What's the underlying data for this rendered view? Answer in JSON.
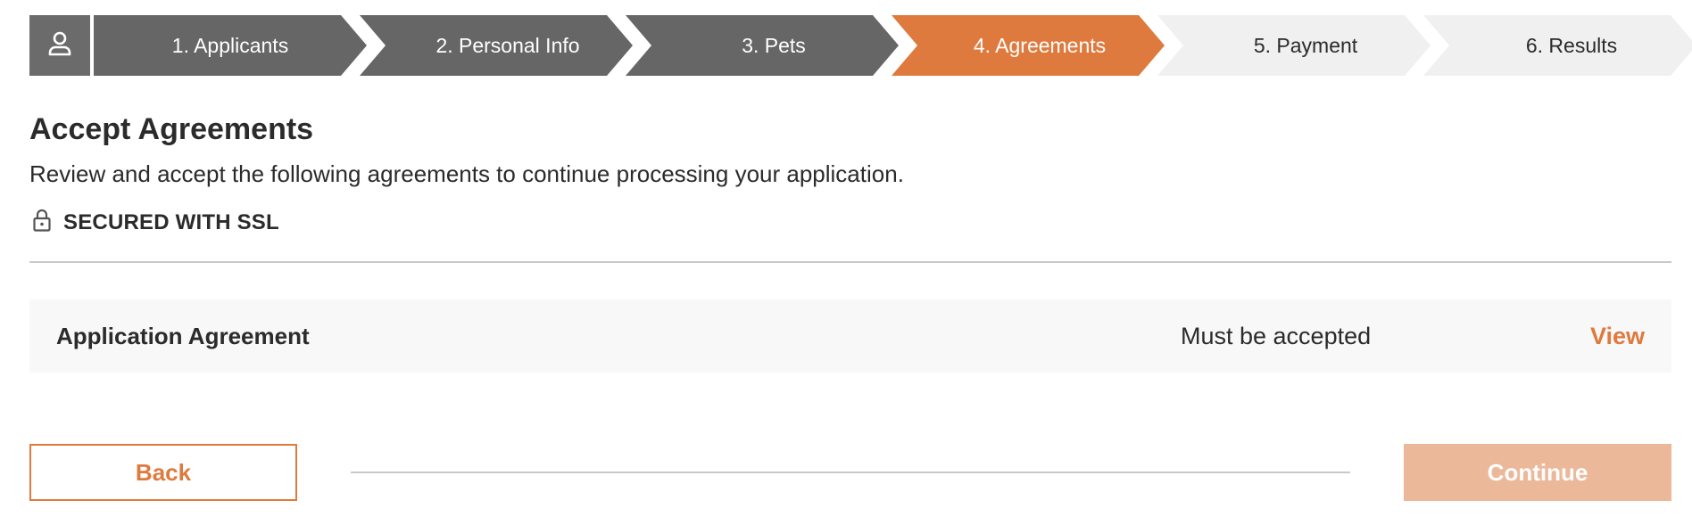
{
  "stepper": {
    "steps": [
      {
        "label": "1. Applicants",
        "state": "done"
      },
      {
        "label": "2. Personal Info",
        "state": "done"
      },
      {
        "label": "3. Pets",
        "state": "done"
      },
      {
        "label": "4. Agreements",
        "state": "active"
      },
      {
        "label": "5. Payment",
        "state": "todo"
      },
      {
        "label": "6. Results",
        "state": "todo"
      }
    ],
    "icon": "user-icon"
  },
  "header": {
    "title": "Accept Agreements",
    "subtitle": "Review and accept the following agreements to continue processing your application.",
    "security_label": "SECURED WITH SSL",
    "security_icon": "lock-icon"
  },
  "agreements": [
    {
      "name": "Application Agreement",
      "status": "Must be accepted",
      "action_label": "View"
    }
  ],
  "footer": {
    "back_label": "Back",
    "continue_label": "Continue"
  },
  "colors": {
    "accent": "#df7a3e",
    "accent_disabled": "#ecb89a",
    "step_done": "#666666",
    "step_todo": "#f0f0f0"
  }
}
